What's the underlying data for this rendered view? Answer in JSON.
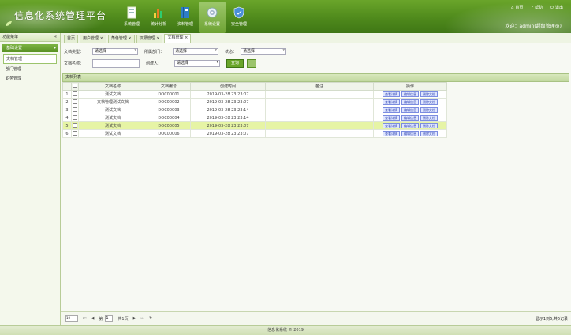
{
  "header": {
    "title": "信息化系统管理平台",
    "nav": [
      {
        "label": "系统管理",
        "icon": "document-icon",
        "active": false
      },
      {
        "label": "统计分析",
        "icon": "bar-chart-icon",
        "active": false
      },
      {
        "label": "资料管理",
        "icon": "book-icon",
        "active": false
      },
      {
        "label": "系统设置",
        "icon": "gear-icon",
        "active": true
      },
      {
        "label": "安全管理",
        "icon": "shield-icon",
        "active": false
      }
    ],
    "top_links": [
      {
        "label": "首页",
        "icon": "home-icon"
      },
      {
        "label": "帮助",
        "icon": "help-icon"
      },
      {
        "label": "退出",
        "icon": "exit-icon"
      }
    ],
    "welcome": "欢迎：admin(超级管理员)"
  },
  "sidebar": {
    "heading": "功能菜单",
    "group": "基础设置",
    "items": [
      {
        "label": "文档管理",
        "active": true
      },
      {
        "label": "部门管理",
        "active": false
      },
      {
        "label": "职务管理",
        "active": false
      }
    ]
  },
  "tabs": [
    {
      "label": "首页",
      "active": false
    },
    {
      "label": "用户管理",
      "active": false
    },
    {
      "label": "角色管理",
      "active": false
    },
    {
      "label": "权限管理",
      "active": false
    },
    {
      "label": "文档管理",
      "active": true
    }
  ],
  "filters": {
    "row1": [
      {
        "label": "文档类型：",
        "value": "请选择"
      },
      {
        "label": "所属部门：",
        "value": "请选择"
      },
      {
        "label": "状态：",
        "value": "请选择"
      }
    ],
    "row2": [
      {
        "label": "文档名称：",
        "value": ""
      },
      {
        "label": "创建人：",
        "value": "请选择"
      }
    ],
    "search_label": "查询"
  },
  "list": {
    "heading": "文档列表",
    "columns": [
      "",
      "文档名称",
      "文档编号",
      "创建时间",
      "备注",
      "操作"
    ],
    "rows": [
      {
        "name": "测试文档",
        "code": "DOC00001",
        "time": "2019-03-28 23:23:07",
        "note": "",
        "highlight": false
      },
      {
        "name": "文档管理测试文档",
        "code": "DOC00002",
        "time": "2019-03-28 23:23:07",
        "note": "",
        "highlight": false
      },
      {
        "name": "测试文档",
        "code": "DOC00003",
        "time": "2019-03-28 23:23:14",
        "note": "",
        "highlight": false
      },
      {
        "name": "测试文档",
        "code": "DOC00004",
        "time": "2019-03-28 23:23:14",
        "note": "",
        "highlight": false
      },
      {
        "name": "测试文档",
        "code": "DOC00005",
        "time": "2019-03-28 23:23:07",
        "note": "",
        "highlight": true
      },
      {
        "name": "测试文档",
        "code": "DOC00006",
        "time": "2019-03-28 23:23:07",
        "note": "",
        "highlight": false
      }
    ],
    "actions": [
      "查看详情",
      "编辑信息",
      "删除文档"
    ]
  },
  "pager": {
    "page_size": "10",
    "page_label": "第",
    "page_value": "1",
    "page_total": "共1页",
    "info": "显示1到6,共6记录"
  },
  "footer": "信息化系统 © 2019",
  "colors": {
    "brand": "#5a9224",
    "highlight": "#e6f4a5",
    "action": "#2a3fb0"
  }
}
